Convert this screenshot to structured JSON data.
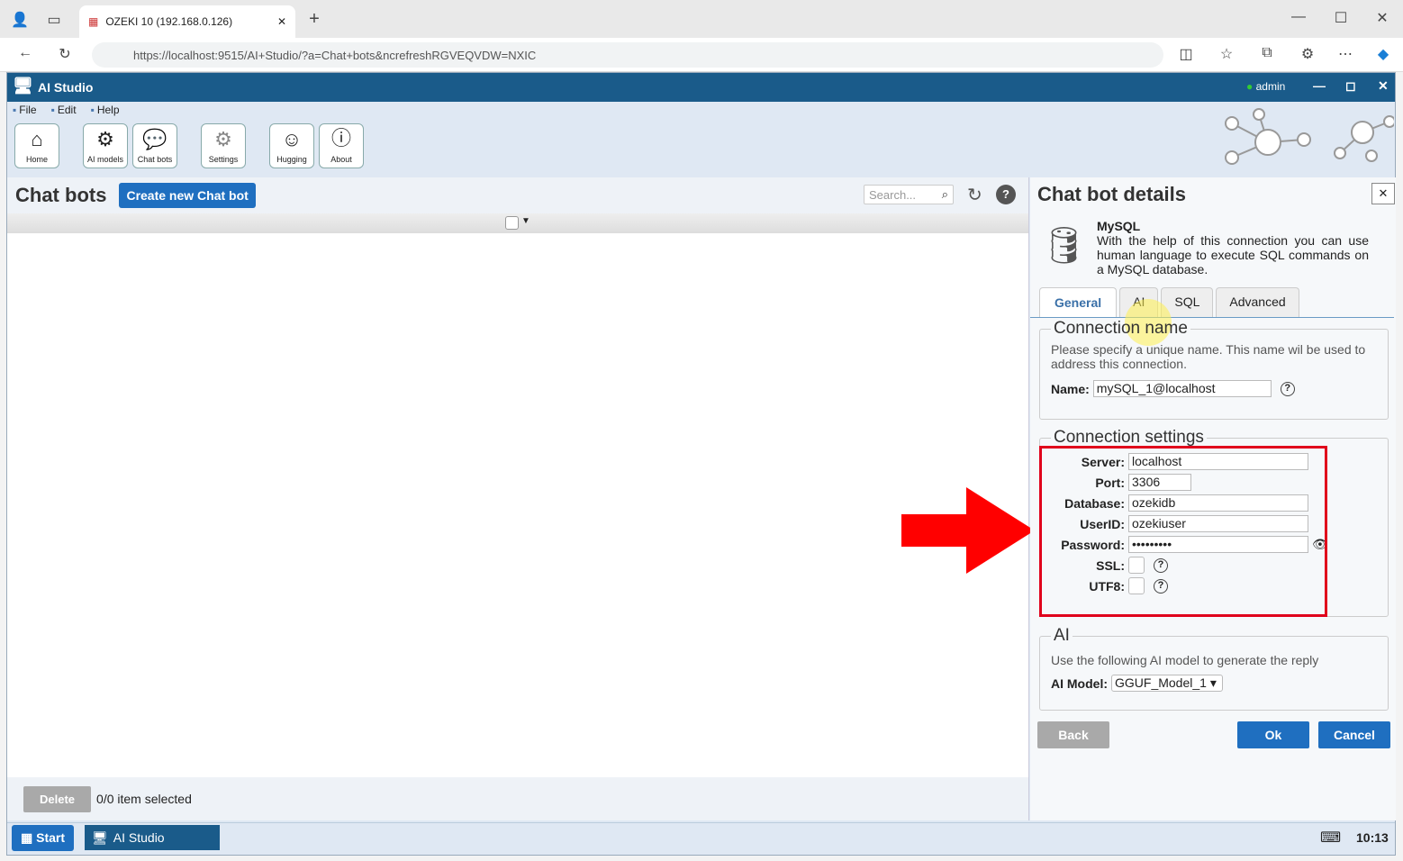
{
  "browser": {
    "tab_title": "OZEKI 10 (192.168.0.126)",
    "url": "https://localhost:9515/AI+Studio/?a=Chat+bots&ncrefreshRGVEQVDW=NXIC"
  },
  "app": {
    "title": "AI Studio",
    "user": "admin",
    "menu": [
      "File",
      "Edit",
      "Help"
    ],
    "toolbar": [
      "Home",
      "AI models",
      "Chat bots",
      "Settings",
      "Hugging",
      "About"
    ]
  },
  "left": {
    "title": "Chat bots",
    "create_label": "Create new Chat bot",
    "search_placeholder": "Search...",
    "delete_label": "Delete",
    "selection_status": "0/0 item selected"
  },
  "details": {
    "title": "Chat bot details",
    "type_name": "MySQL",
    "description": "With the help of this connection you can use human language to execute SQL commands on a MySQL database.",
    "tabs": [
      "General",
      "AI",
      "SQL",
      "Advanced"
    ],
    "conn_name": {
      "legend": "Connection name",
      "help": "Please specify a unique name. This name wil be used to address this connection.",
      "label": "Name:",
      "value": "mySQL_1@localhost"
    },
    "conn_settings": {
      "legend": "Connection settings",
      "server_label": "Server:",
      "server": "localhost",
      "port_label": "Port:",
      "port": "3306",
      "database_label": "Database:",
      "database": "ozekidb",
      "userid_label": "UserID:",
      "userid": "ozekiuser",
      "password_label": "Password:",
      "password": "•••••••••",
      "ssl_label": "SSL:",
      "utf8_label": "UTF8:"
    },
    "ai": {
      "legend": "AI",
      "help": "Use the following AI model to generate the reply",
      "label": "AI Model:",
      "value": "GGUF_Model_1"
    },
    "back": "Back",
    "ok": "Ok",
    "cancel": "Cancel"
  },
  "taskbar": {
    "start": "Start",
    "app": "AI Studio",
    "clock": "10:13"
  },
  "colors": {
    "accent": "#1f6fc0",
    "title_bar": "#1a5b8a",
    "highlight_box": "#e0001b",
    "arrow": "#ff0000"
  }
}
